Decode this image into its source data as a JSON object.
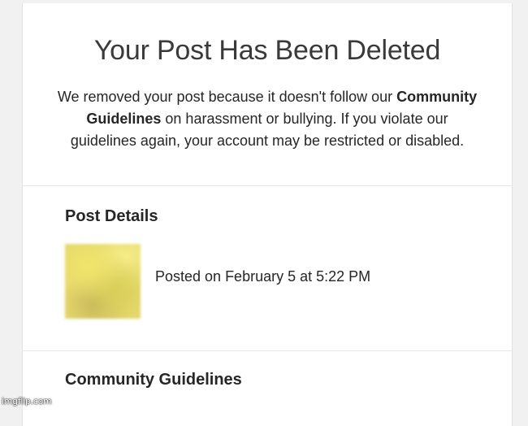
{
  "notice": {
    "title": "Your Post Has Been Deleted",
    "message_part1": "We removed your post because it doesn't follow our ",
    "message_link": "Community Guidelines",
    "message_part2": " on harassment or bullying. If you violate our guidelines again, your account may be restricted or disabled."
  },
  "post_details": {
    "heading": "Post Details",
    "posted_text": "Posted on February 5 at 5:22 PM"
  },
  "community_guidelines": {
    "heading": "Community Guidelines"
  },
  "watermark": {
    "text": "imgflip.com"
  },
  "colors": {
    "background": "#f1f1f1",
    "card": "#ffffff",
    "text": "#262626",
    "thumbnail": "#e4d86c"
  }
}
